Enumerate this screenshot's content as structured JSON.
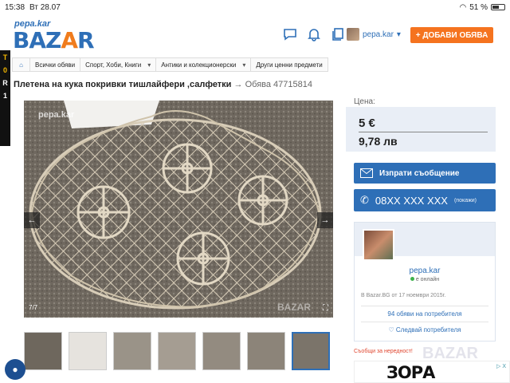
{
  "status": {
    "time": "15:38",
    "date": "Вт 28.07",
    "battery": "51 %"
  },
  "header": {
    "logo_small": "pepa.kar",
    "logo_big_prefix": "BAZ",
    "logo_big_a": "A",
    "logo_big_suffix": "R",
    "username": "pepa.kar",
    "add_button": "+ ДОБАВИ ОБЯВА"
  },
  "left_ad": [
    "T",
    "0",
    "R",
    "1"
  ],
  "breadcrumb": [
    "Всички обяви",
    "Спорт, Хоби, Книги",
    "Антики и колекционерски",
    "Други ценни предмети"
  ],
  "listing": {
    "title": "Плетена на кука покривки тишлайфери ,салфетки",
    "arrow": "→",
    "id_text": "Обява 47715814",
    "gallery_watermark": "pepa.kar",
    "gallery_watermark2": "BAZAR",
    "counter": "7/7",
    "thumb_count": 7,
    "active_thumb": 7
  },
  "price": {
    "label": "Цена:",
    "eur": "5 €",
    "bgn": "9,78 лв"
  },
  "actions": {
    "message": "Изпрати съобщение",
    "phone": "08XX XXX XXX",
    "phone_show": "(покажи)"
  },
  "seller": {
    "name": "pepa.kar",
    "status": "е онлайн",
    "since": "В Bazar.BG от 17 ноември 2015г.",
    "ads": "94 обяви на потребителя",
    "follow": "Следвай потребителя"
  },
  "report": "Съобщи за нередност!",
  "ad": {
    "brand": "ЗОРА",
    "flag": "▷ X",
    "bazar_watermark": "BAZAR"
  },
  "colors": {
    "primary": "#2e6fb7",
    "accent": "#f5731f",
    "price_bg": "#e9eef6"
  }
}
